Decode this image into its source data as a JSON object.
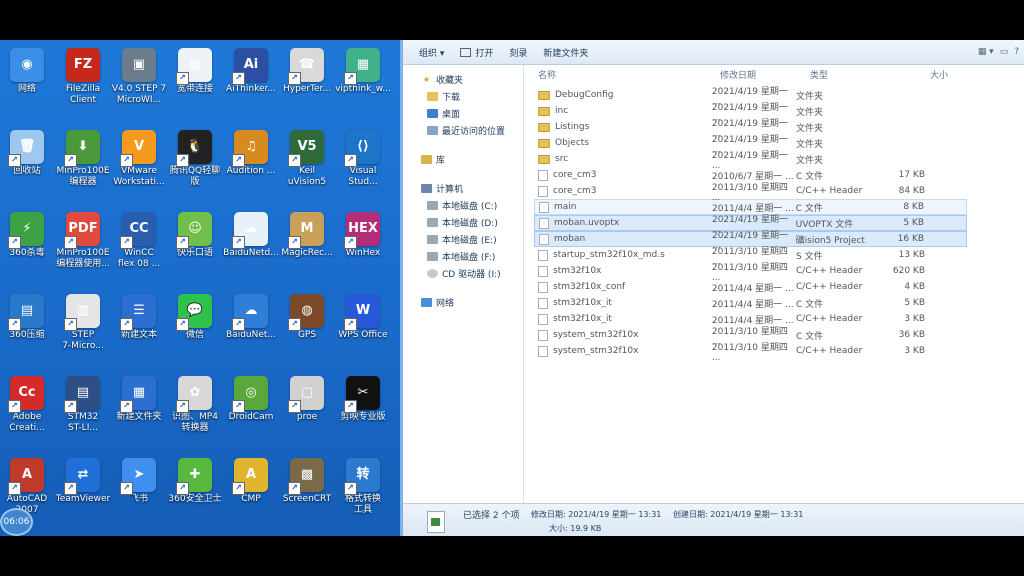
{
  "desktop": {
    "icons": [
      {
        "label": "网络",
        "color": "#3a8ee6",
        "glyph": "◉",
        "icon": "network-icon"
      },
      {
        "label": "FileZilla\nClient",
        "color": "#c6281c",
        "glyph": "FZ",
        "icon": "filezilla-icon"
      },
      {
        "label": "V4.0 STEP 7\nMicroWI...",
        "color": "#6b7c8c",
        "glyph": "▣",
        "icon": "step7-icon"
      },
      {
        "label": "宽带连接",
        "color": "#eef2f6",
        "glyph": "▤",
        "icon": "broadband-icon"
      },
      {
        "label": "AiThinker...",
        "color": "#2c4fa3",
        "glyph": "Ai",
        "icon": "aithinker-icon"
      },
      {
        "label": "HyperTer...",
        "color": "#d9d9d9",
        "glyph": "☎",
        "icon": "hyperterminal-icon"
      },
      {
        "label": "vipthink_w...",
        "color": "#3fb28c",
        "glyph": "▦",
        "icon": "vipthink-icon"
      },
      {
        "label": "回收站",
        "color": "#9fc8ee",
        "glyph": "🗑",
        "icon": "recycle-bin-icon"
      },
      {
        "label": "MinPro100E\n编程器",
        "color": "#4a9a3c",
        "glyph": "⬇",
        "icon": "minpro-programmer-icon"
      },
      {
        "label": "VMware\nWorkstati...",
        "color": "#f39a1f",
        "glyph": "V",
        "icon": "vmware-icon"
      },
      {
        "label": "腾讯QQ轻聊\n版",
        "color": "#222",
        "glyph": "🐧",
        "icon": "qq-icon"
      },
      {
        "label": "Audition ...",
        "color": "#d78a1f",
        "glyph": "♫",
        "icon": "audition-icon"
      },
      {
        "label": "Keil\nuVision5",
        "color": "#2f6b3a",
        "glyph": "V5",
        "icon": "keil-icon"
      },
      {
        "label": "Visual\nStud...",
        "color": "#1d74c9",
        "glyph": "⟨⟩",
        "icon": "visual-studio-icon"
      },
      {
        "label": "360杀毒",
        "color": "#3ca245",
        "glyph": "⚡",
        "icon": "antivirus-icon"
      },
      {
        "label": "MinPro100E\n编程器使用...",
        "color": "#e04a3c",
        "glyph": "PDF",
        "icon": "pdf-icon"
      },
      {
        "label": "WinCC\nflex 08 ...",
        "color": "#2a5db0",
        "glyph": "CC",
        "icon": "wincc-icon"
      },
      {
        "label": "快乐口语",
        "color": "#6fbf4a",
        "glyph": "☺",
        "icon": "kuaile-icon"
      },
      {
        "label": "BaiduNetd...",
        "color": "#e8f1fb",
        "glyph": "☁",
        "icon": "baidu-netdisk-icon"
      },
      {
        "label": "MagicRec...",
        "color": "#c9a05a",
        "glyph": "M",
        "icon": "magicrec-icon"
      },
      {
        "label": "WinHex",
        "color": "#b32d79",
        "glyph": "HEX",
        "icon": "winhex-icon"
      },
      {
        "label": "360压缩",
        "color": "#2a78c9",
        "glyph": "▤",
        "icon": "zip-icon"
      },
      {
        "label": "STEP\n7-Micro...",
        "color": "#e5e5e5",
        "glyph": "▥",
        "icon": "step7-micro-icon"
      },
      {
        "label": "新建文本",
        "color": "#2d6fd0",
        "glyph": "☰",
        "icon": "text-doc-icon"
      },
      {
        "label": "微信",
        "color": "#2fc24a",
        "glyph": "💬",
        "icon": "wechat-icon"
      },
      {
        "label": "BaiduNet...",
        "color": "#2f7fd9",
        "glyph": "☁",
        "icon": "baidu-net-icon"
      },
      {
        "label": "GPS",
        "color": "#7a4a2a",
        "glyph": "◍",
        "icon": "gps-icon"
      },
      {
        "label": "WPS Office",
        "color": "#2758d8",
        "glyph": "W",
        "icon": "wps-icon"
      },
      {
        "label": "Adobe\nCreati...",
        "color": "#d42a2a",
        "glyph": "Cc",
        "icon": "adobe-icon"
      },
      {
        "label": "STM32\nST-LI...",
        "color": "#2e4f86",
        "glyph": "▤",
        "icon": "stm32-stlink-icon"
      },
      {
        "label": "新建文件夹",
        "color": "#2d6fd0",
        "glyph": "▦",
        "icon": "new-folder-app-icon"
      },
      {
        "label": "识图、MP4\n转换器",
        "color": "#d8d8d8",
        "glyph": "✿",
        "icon": "converter-icon"
      },
      {
        "label": "DroidCam",
        "color": "#5aa83c",
        "glyph": "◎",
        "icon": "droidcam-icon"
      },
      {
        "label": "proe",
        "color": "#d0d0d0",
        "glyph": "▢",
        "icon": "proe-icon"
      },
      {
        "label": "剪映专业版",
        "color": "#111",
        "glyph": "✂",
        "icon": "jianying-icon"
      },
      {
        "label": "AutoCAD\n2007",
        "color": "#c0392b",
        "glyph": "A",
        "icon": "autocad-icon"
      },
      {
        "label": "TeamViewer",
        "color": "#1f6fd8",
        "glyph": "⇄",
        "icon": "teamviewer-icon"
      },
      {
        "label": "飞书",
        "color": "#3e8ff0",
        "glyph": "➤",
        "icon": "feishu-icon"
      },
      {
        "label": "360安全卫士",
        "color": "#56b83c",
        "glyph": "✚",
        "icon": "360-safe-icon"
      },
      {
        "label": "CMP",
        "color": "#e0b42c",
        "glyph": "A",
        "icon": "cmp-icon"
      },
      {
        "label": "ScreenCRT",
        "color": "#7a6a4a",
        "glyph": "▩",
        "icon": "screencrt-icon"
      },
      {
        "label": "格式转换\n工具",
        "color": "#2a7ad0",
        "glyph": "转",
        "icon": "format-converter-icon"
      }
    ],
    "clock": "06:06"
  },
  "explorer": {
    "toolbar": {
      "organize": "组织 ▾",
      "open": "打开",
      "burn": "刻录",
      "new_folder": "新建文件夹"
    },
    "nav": {
      "favorites": "收藏夹",
      "downloads": "下载",
      "desktop": "桌面",
      "recent": "最近访问的位置",
      "libraries": "库",
      "computer": "计算机",
      "drives": [
        "本地磁盘 (C:)",
        "本地磁盘 (D:)",
        "本地磁盘 (E:)",
        "本地磁盘 (F:)",
        "CD 驱动器 (I:)"
      ],
      "network": "网络"
    },
    "columns": {
      "name": "名称",
      "date": "修改日期",
      "type": "类型",
      "size": "大小"
    },
    "files": [
      {
        "name": "DebugConfig",
        "date": "2021/4/19 星期一 ...",
        "type": "文件夹",
        "size": "",
        "kind": "folder",
        "state": ""
      },
      {
        "name": "inc",
        "date": "2021/4/19 星期一 ...",
        "type": "文件夹",
        "size": "",
        "kind": "folder",
        "state": ""
      },
      {
        "name": "Listings",
        "date": "2021/4/19 星期一 ...",
        "type": "文件夹",
        "size": "",
        "kind": "folder",
        "state": ""
      },
      {
        "name": "Objects",
        "date": "2021/4/19 星期一 ...",
        "type": "文件夹",
        "size": "",
        "kind": "folder",
        "state": ""
      },
      {
        "name": "src",
        "date": "2021/4/19 星期一 ...",
        "type": "文件夹",
        "size": "",
        "kind": "folder",
        "state": ""
      },
      {
        "name": "core_cm3",
        "date": "2010/6/7 星期一 ...",
        "type": "C 文件",
        "size": "17 KB",
        "kind": "file",
        "state": ""
      },
      {
        "name": "core_cm3",
        "date": "2011/3/10 星期四 ...",
        "type": "C/C++ Header",
        "size": "84 KB",
        "kind": "file",
        "state": ""
      },
      {
        "name": "main",
        "date": "2011/4/4 星期一 ...",
        "type": "C 文件",
        "size": "8 KB",
        "kind": "file",
        "state": "hov"
      },
      {
        "name": "moban.uvoptx",
        "date": "2021/4/19 星期一 ...",
        "type": "UVOPTX 文件",
        "size": "5 KB",
        "kind": "file",
        "state": "sel"
      },
      {
        "name": "moban",
        "date": "2021/4/19 星期一 ...",
        "type": "礦ision5 Project",
        "size": "16 KB",
        "kind": "file",
        "state": "sel"
      },
      {
        "name": "startup_stm32f10x_md.s",
        "date": "2011/3/10 星期四 ...",
        "type": "S 文件",
        "size": "13 KB",
        "kind": "file",
        "state": ""
      },
      {
        "name": "stm32f10x",
        "date": "2011/3/10 星期四 ...",
        "type": "C/C++ Header",
        "size": "620 KB",
        "kind": "file",
        "state": ""
      },
      {
        "name": "stm32f10x_conf",
        "date": "2011/4/4 星期一 ...",
        "type": "C/C++ Header",
        "size": "4 KB",
        "kind": "file",
        "state": ""
      },
      {
        "name": "stm32f10x_it",
        "date": "2011/4/4 星期一 ...",
        "type": "C 文件",
        "size": "5 KB",
        "kind": "file",
        "state": ""
      },
      {
        "name": "stm32f10x_it",
        "date": "2011/4/4 星期一 ...",
        "type": "C/C++ Header",
        "size": "3 KB",
        "kind": "file",
        "state": ""
      },
      {
        "name": "system_stm32f10x",
        "date": "2011/3/10 星期四 ...",
        "type": "C 文件",
        "size": "36 KB",
        "kind": "file",
        "state": ""
      },
      {
        "name": "system_stm32f10x",
        "date": "2011/3/10 星期四 ...",
        "type": "C/C++ Header",
        "size": "3 KB",
        "kind": "file",
        "state": ""
      }
    ],
    "status": {
      "selected": "已选择 2 个项",
      "modified": "修改日期: 2021/4/19 星期一 13:31",
      "created": "创建日期: 2021/4/19 星期一 13:31",
      "size": "大小: 19.9 KB"
    }
  }
}
